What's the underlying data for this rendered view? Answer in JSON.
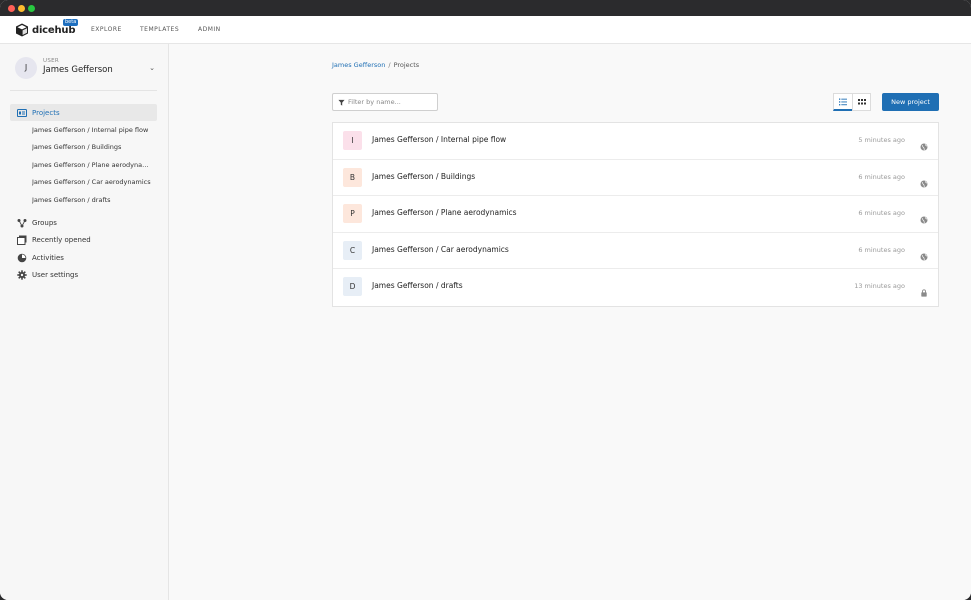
{
  "brand": {
    "name": "dicehub",
    "badge": "beta"
  },
  "topnav": {
    "items": [
      "EXPLORE",
      "TEMPLATES",
      "ADMIN"
    ]
  },
  "user": {
    "label": "USER",
    "name": "James Gefferson",
    "initial": "J"
  },
  "sidebar": {
    "projects_label": "Projects",
    "project_items": [
      "James Gefferson / Internal pipe flow",
      "James Gefferson / Buildings",
      "James Gefferson / Plane aerodynamics",
      "James Gefferson / Car aerodynamics",
      "James Gefferson / drafts"
    ],
    "items": [
      {
        "label": "Groups",
        "icon": "groups-icon"
      },
      {
        "label": "Recently opened",
        "icon": "recent-icon"
      },
      {
        "label": "Activities",
        "icon": "activities-icon"
      },
      {
        "label": "User settings",
        "icon": "gear-icon"
      }
    ]
  },
  "breadcrumb": {
    "owner": "James Gefferson",
    "separator": "/",
    "current": "Projects"
  },
  "filter": {
    "placeholder": "Filter by name...",
    "value": ""
  },
  "new_project_label": "New project",
  "projects": [
    {
      "letter": "I",
      "name": "James Gefferson / Internal pipe flow",
      "time": "5 minutes ago",
      "visibility": "public",
      "color": "#fbe0ea"
    },
    {
      "letter": "B",
      "name": "James Gefferson / Buildings",
      "time": "6 minutes ago",
      "visibility": "public",
      "color": "#fde7dc"
    },
    {
      "letter": "P",
      "name": "James Gefferson / Plane aerodynamics",
      "time": "6 minutes ago",
      "visibility": "public",
      "color": "#fde7dc"
    },
    {
      "letter": "C",
      "name": "James Gefferson / Car aerodynamics",
      "time": "6 minutes ago",
      "visibility": "public",
      "color": "#e7eef6"
    },
    {
      "letter": "D",
      "name": "James Gefferson / drafts",
      "time": "13 minutes ago",
      "visibility": "private",
      "color": "#e7eef6"
    }
  ],
  "colors": {
    "accent": "#1f6fb4",
    "sidebar_bg": "#f7f7f7"
  }
}
